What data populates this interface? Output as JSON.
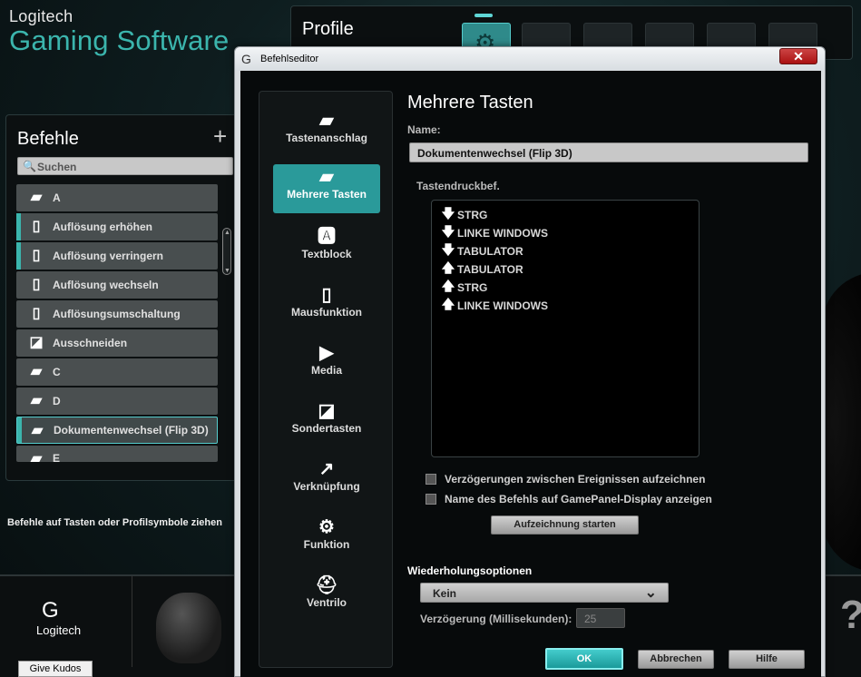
{
  "brand": {
    "line1": "Logitech",
    "line2": "Gaming Software"
  },
  "profile": {
    "title": "Profile"
  },
  "commands": {
    "title": "Befehle",
    "add_label": "+",
    "search_placeholder": "Suchen",
    "items": [
      {
        "label": "A",
        "icon": "key-icon"
      },
      {
        "label": "Auflösung erhöhen",
        "icon": "mouse-icon"
      },
      {
        "label": "Auflösung verringern",
        "icon": "mouse-icon"
      },
      {
        "label": "Auflösung wechseln",
        "icon": "mouse-icon"
      },
      {
        "label": "Auflösungsumschaltung",
        "icon": "mouse-icon"
      },
      {
        "label": "Ausschneiden",
        "icon": "special-key-icon"
      },
      {
        "label": "C",
        "icon": "key-icon"
      },
      {
        "label": "D",
        "icon": "key-icon"
      },
      {
        "label": "Dokumentenwechsel (Flip 3D)",
        "icon": "multi-key-icon"
      },
      {
        "label": "E",
        "icon": "key-icon"
      }
    ],
    "hint": "Befehle auf Tasten oder Profilsymbole ziehen"
  },
  "footer": {
    "logo_text": "Logitech",
    "kudos": "Give Kudos",
    "help": "?"
  },
  "dialog": {
    "title": "Befehlseditor",
    "close_label": "✕",
    "nav": [
      {
        "label": "Tastenanschlag",
        "icon": "keystroke-icon"
      },
      {
        "label": "Mehrere Tasten",
        "icon": "multi-key-icon",
        "active": true
      },
      {
        "label": "Textblock",
        "icon": "text-block-icon"
      },
      {
        "label": "Mausfunktion",
        "icon": "mouse-function-icon"
      },
      {
        "label": "Media",
        "icon": "play-icon"
      },
      {
        "label": "Sondertasten",
        "icon": "special-key-icon"
      },
      {
        "label": "Verknüpfung",
        "icon": "shortcut-arrow-icon"
      },
      {
        "label": "Funktion",
        "icon": "function-gear-icon"
      },
      {
        "label": "Ventrilo",
        "icon": "ventrilo-icon"
      }
    ],
    "heading": "Mehrere Tasten",
    "name_label": "Name:",
    "name_value": "Dokumentenwechsel (Flip 3D)",
    "keystrokes_label": "Tastendruckbef.",
    "keystrokes": [
      {
        "dir": "down",
        "key": "STRG"
      },
      {
        "dir": "down",
        "key": "LINKE WINDOWS"
      },
      {
        "dir": "down",
        "key": "TABULATOR"
      },
      {
        "dir": "up",
        "key": "TABULATOR"
      },
      {
        "dir": "up",
        "key": "STRG"
      },
      {
        "dir": "up",
        "key": "LINKE WINDOWS"
      }
    ],
    "checkbox_delays": "Verzögerungen zwischen Ereignissen aufzeichnen",
    "checkbox_display": "Name des Befehls auf GamePanel-Display anzeigen",
    "record_button": "Aufzeichnung starten",
    "repeat_label": "Wiederholungsoptionen",
    "repeat_value": "Kein",
    "delay_label": "Verzögerung (Millisekunden):",
    "delay_value": "25",
    "ok": "OK",
    "cancel": "Abbrechen",
    "help": "Hilfe"
  }
}
